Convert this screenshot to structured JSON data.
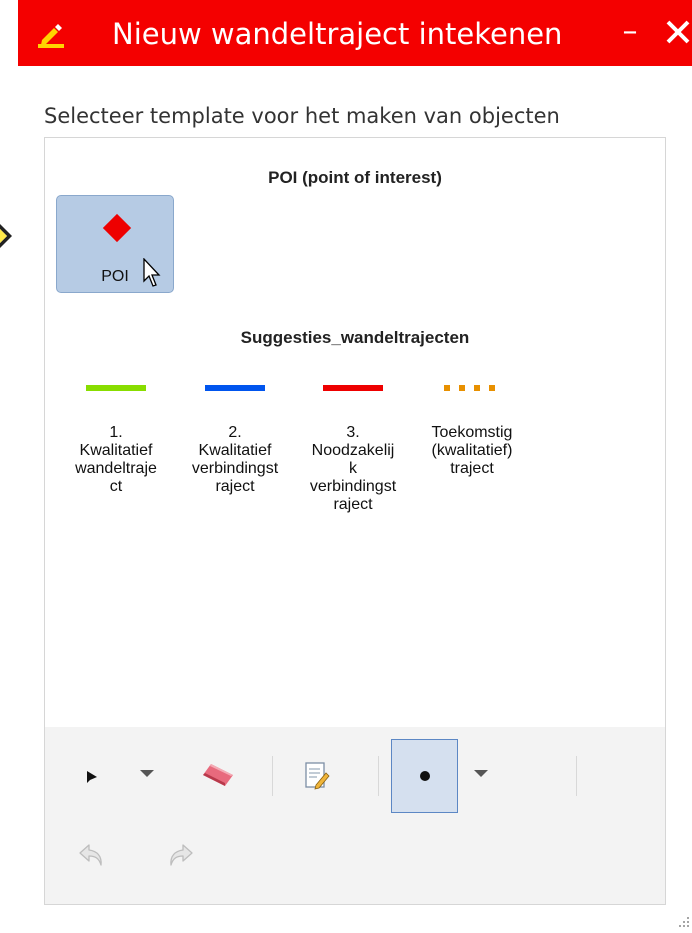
{
  "window": {
    "title": "Nieuw wandeltraject intekenen",
    "minimize_label": "–"
  },
  "picker": {
    "instruction": "Selecteer template voor het maken van objecten",
    "groups": [
      {
        "title": "POI (point of interest)",
        "templates": [
          {
            "label": "POI",
            "symbol": "diamond",
            "color": "#ee0000",
            "selected": true
          }
        ]
      },
      {
        "title": "Suggesties_wandeltrajecten",
        "templates": [
          {
            "label": "1.\nKwalitatief\nwandeltraje\nct",
            "symbol": "solid-line",
            "color": "#88dd00"
          },
          {
            "label": "2.\nKwalitatief\nverbindingst\nraject",
            "symbol": "solid-line",
            "color": "#0055ee"
          },
          {
            "label": "3.\nNoodzakelij\nk\nverbindingst\nraject",
            "symbol": "solid-line",
            "color": "#ee0000"
          },
          {
            "label": "Toekomstig\n(kwalitatief)\ntraject",
            "symbol": "dotted-line",
            "color": "#e89000"
          }
        ]
      }
    ]
  },
  "toolbar": {
    "tools": [
      {
        "name": "select-arrow-icon"
      },
      {
        "name": "select-dropdown-chevron-icon"
      },
      {
        "name": "eraser-icon"
      },
      {
        "name": "edit-attributes-icon"
      },
      {
        "name": "point-tool-icon",
        "active": true
      },
      {
        "name": "point-tool-dropdown-chevron-icon"
      },
      {
        "name": "undo-icon",
        "enabled": false
      },
      {
        "name": "redo-icon",
        "enabled": false
      }
    ]
  },
  "colors": {
    "titlebar": "#f40000",
    "selected_template": "#b6cbe4",
    "toolbar_background": "#f3f3f3"
  }
}
